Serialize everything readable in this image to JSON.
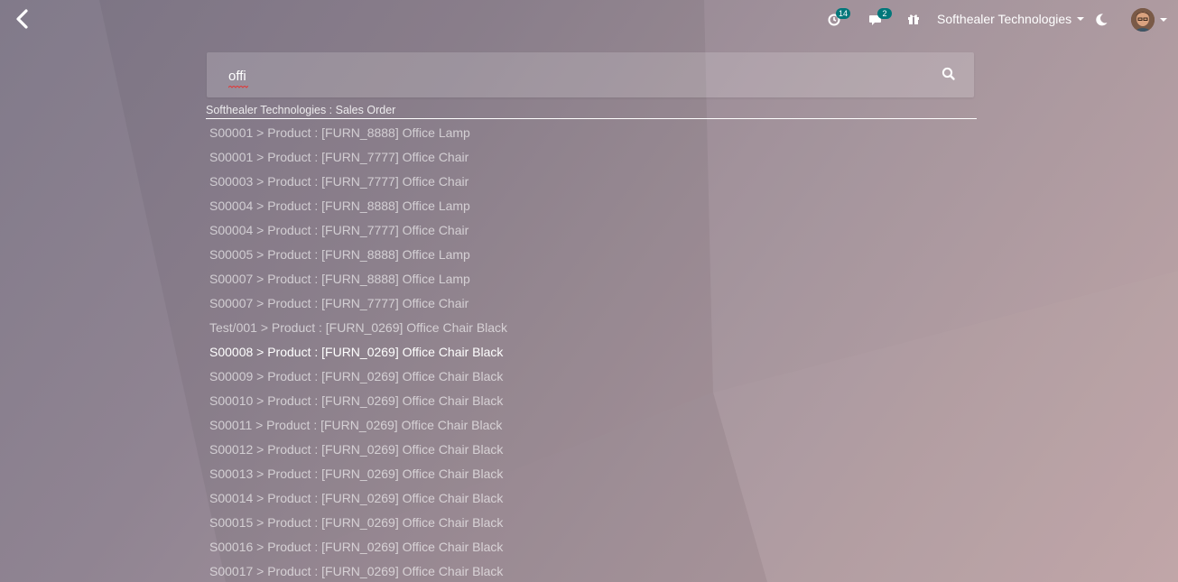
{
  "topbar": {
    "back_icon": "chevron-left-icon",
    "activity_badge": "14",
    "messages_badge": "2",
    "company_name": "Softhealer Technologies"
  },
  "search": {
    "query": "offi",
    "button_icon": "search-icon"
  },
  "results": {
    "group_title": "Softhealer Technologies : Sales Order",
    "focused_index": 9,
    "items": [
      "S00001 > Product : [FURN_8888] Office Lamp",
      "S00001 > Product : [FURN_7777] Office Chair",
      "S00003 > Product : [FURN_7777] Office Chair",
      "S00004 > Product : [FURN_8888] Office Lamp",
      "S00004 > Product : [FURN_7777] Office Chair",
      "S00005 > Product : [FURN_8888] Office Lamp",
      "S00007 > Product : [FURN_8888] Office Lamp",
      "S00007 > Product : [FURN_7777] Office Chair",
      "Test/001 > Product : [FURN_0269] Office Chair Black",
      "S00008 > Product : [FURN_0269] Office Chair Black",
      "S00009 > Product : [FURN_0269] Office Chair Black",
      "S00010 > Product : [FURN_0269] Office Chair Black",
      "S00011 > Product : [FURN_0269] Office Chair Black",
      "S00012 > Product : [FURN_0269] Office Chair Black",
      "S00013 > Product : [FURN_0269] Office Chair Black",
      "S00014 > Product : [FURN_0269] Office Chair Black",
      "S00015 > Product : [FURN_0269] Office Chair Black",
      "S00016 > Product : [FURN_0269] Office Chair Black",
      "S00017 > Product : [FURN_0269] Office Chair Black"
    ]
  }
}
